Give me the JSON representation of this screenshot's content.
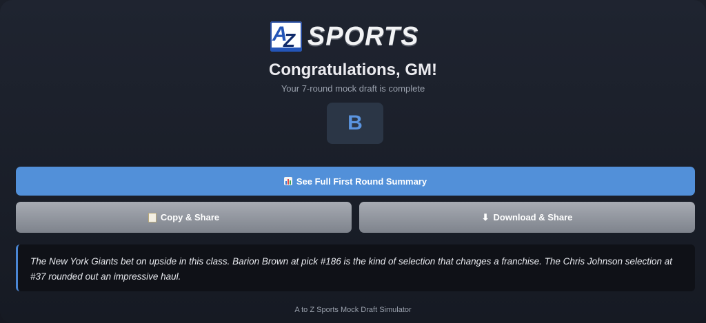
{
  "logo": {
    "mark_a": "A",
    "mark_z": "Z",
    "text": "SPORTS"
  },
  "header": {
    "title": "Congratulations, GM!",
    "subtitle": "Your 7-round mock draft is complete"
  },
  "grade": {
    "value": "B",
    "color": "#5b95e0"
  },
  "buttons": {
    "summary": {
      "label": "See Full First Round Summary",
      "icon": "bar-chart-icon"
    },
    "copy": {
      "label": "Copy & Share",
      "icon": "clipboard-icon"
    },
    "download": {
      "label": "Download & Share",
      "icon": "download-arrow-icon"
    }
  },
  "summary_text": "The New York Giants bet on upside in this class. Barion Brown at pick #186 is the kind of selection that changes a franchise. The Chris Johnson selection at #37 rounded out an impressive haul.",
  "footer": "A to Z Sports Mock Draft Simulator",
  "colors": {
    "accent": "#5290d9",
    "secondary_button": "#8f949c",
    "quote_border": "#4a86d4"
  }
}
